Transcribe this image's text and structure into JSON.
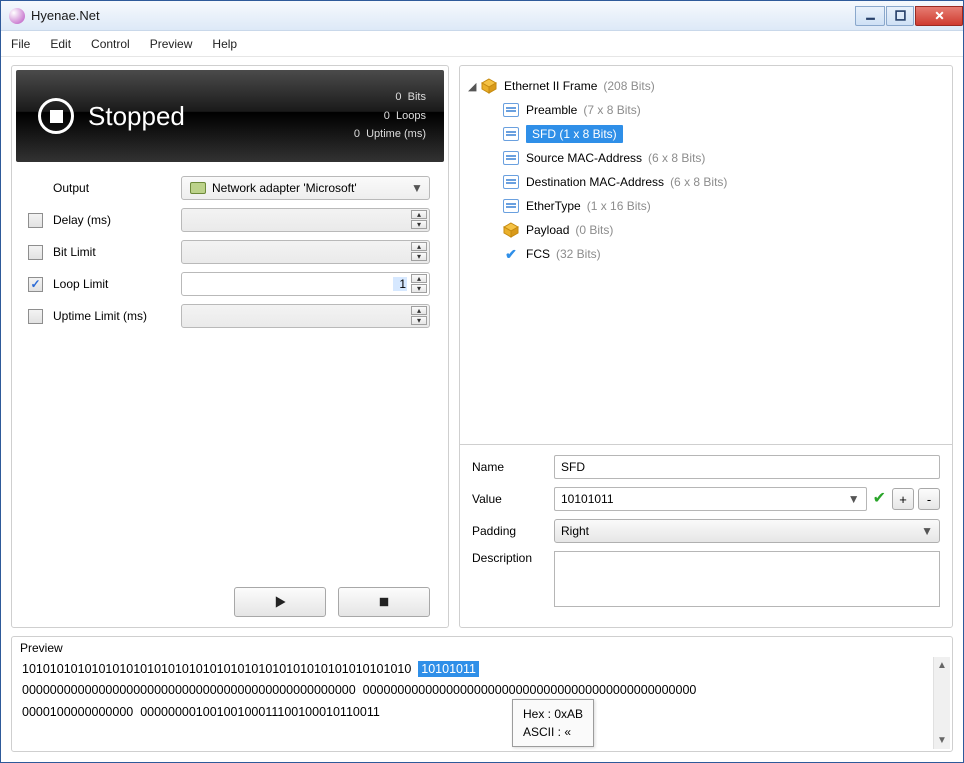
{
  "window": {
    "title": "Hyenae.Net"
  },
  "menu": {
    "file": "File",
    "edit": "Edit",
    "control": "Control",
    "preview": "Preview",
    "help": "Help"
  },
  "status": {
    "title": "Stopped",
    "bits_val": "0",
    "bits_lbl": "Bits",
    "loops_val": "0",
    "loops_lbl": "Loops",
    "uptime_val": "0",
    "uptime_lbl": "Uptime (ms)"
  },
  "form": {
    "output_label": "Output",
    "output_value": "Network adapter 'Microsoft'",
    "delay_label": "Delay (ms)",
    "bitlimit_label": "Bit Limit",
    "looplimit_label": "Loop Limit",
    "looplimit_value": "1",
    "uptimelimit_label": "Uptime Limit (ms)"
  },
  "tree": {
    "root_label": "Ethernet II Frame",
    "root_meta": "(208 Bits)",
    "items": [
      {
        "label": "Preamble",
        "meta": "(7 x 8 Bits)",
        "icon": "box"
      },
      {
        "label": "SFD",
        "meta": "(1 x 8 Bits)",
        "icon": "box",
        "selected": true
      },
      {
        "label": "Source MAC-Address",
        "meta": "(6 x 8 Bits)",
        "icon": "box"
      },
      {
        "label": "Destination MAC-Address",
        "meta": "(6 x 8 Bits)",
        "icon": "box"
      },
      {
        "label": "EtherType",
        "meta": "(1 x 16 Bits)",
        "icon": "box"
      },
      {
        "label": "Payload",
        "meta": "(0 Bits)",
        "icon": "cube"
      },
      {
        "label": "FCS",
        "meta": "(32 Bits)",
        "icon": "check"
      }
    ]
  },
  "details": {
    "name_label": "Name",
    "name_value": "SFD",
    "value_label": "Value",
    "value_value": "10101011",
    "padding_label": "Padding",
    "padding_value": "Right",
    "description_label": "Description",
    "plus": "+",
    "minus": "-"
  },
  "preview": {
    "title": "Preview",
    "seg1": "10101010101010101010101010101010101010101010101010101010",
    "hl": "10101011",
    "seg2a": "000000000000000000000000000000000000000000000000",
    "seg2b": "0000000000000000",
    "seg2c": "00000000000000000000000000000000",
    "seg3a": "0000100000000000",
    "seg3b": "00000000100100100011100100010110011",
    "tooltip_hex": "Hex : 0xAB",
    "tooltip_ascii": "ASCII : «"
  }
}
